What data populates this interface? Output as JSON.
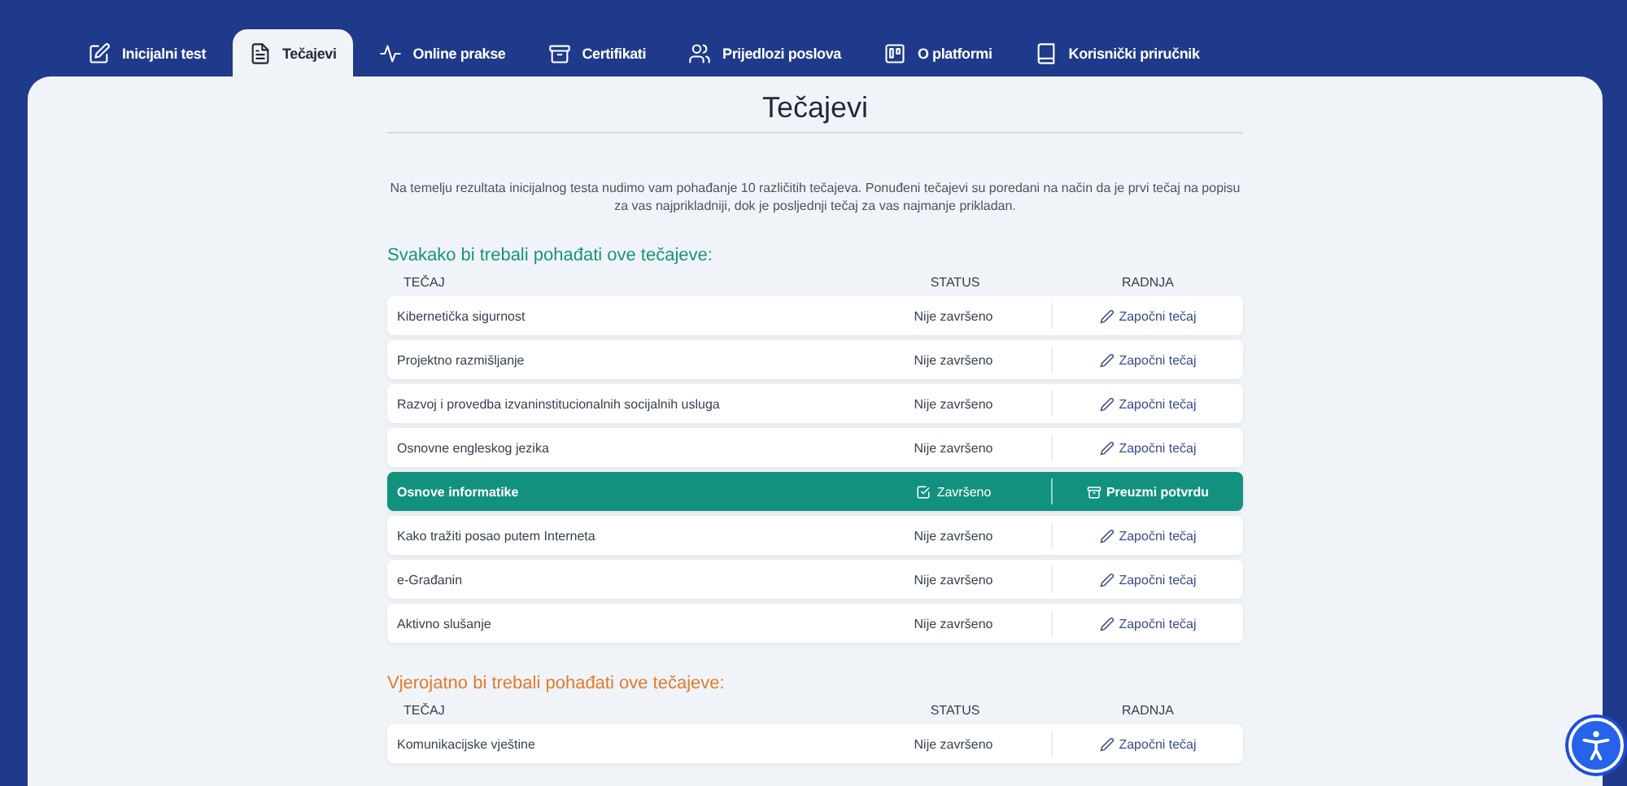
{
  "tabs": [
    {
      "label": "Inicijalni test",
      "kind": "test",
      "selected": false
    },
    {
      "label": "Tečajevi",
      "kind": "courses",
      "selected": true
    },
    {
      "label": "Online prakse",
      "kind": "practice",
      "selected": false
    },
    {
      "label": "Certifikati",
      "kind": "certificates",
      "selected": false
    },
    {
      "label": "Prijedlozi poslova",
      "kind": "jobs",
      "selected": false
    },
    {
      "label": "O platformi",
      "kind": "about",
      "selected": false
    },
    {
      "label": "Korisnički priručnik",
      "kind": "manual",
      "selected": false
    }
  ],
  "page": {
    "title": "Tečajevi",
    "intro": "Na temelju rezultata inicijalnog testa nudimo vam pohađanje 10 različitih tečajeva. Ponuđeni tečajevi su poredani na način da je prvi tečaj na popisu za vas najprikladniji, dok je posljednji tečaj za vas najmanje prikladan."
  },
  "sections": [
    {
      "heading": "Svakako bi trebali pohađati ove tečajeve:",
      "color": "#16947f",
      "columns": [
        "TEČAJ",
        "STATUS",
        "RADNJA"
      ],
      "rows": [
        {
          "course": "Kibernetička sigurnost",
          "status": "Nije završeno",
          "action": "Započni tečaj",
          "completed": false
        },
        {
          "course": "Projektno razmišljanje",
          "status": "Nije završeno",
          "action": "Započni tečaj",
          "completed": false
        },
        {
          "course": "Razvoj i provedba izvaninstitucionalnih socijalnih usluga",
          "status": "Nije završeno",
          "action": "Započni tečaj",
          "completed": false
        },
        {
          "course": "Osnovne engleskog jezika",
          "status": "Nije završeno",
          "action": "Započni tečaj",
          "completed": false
        },
        {
          "course": "Osnove informatike",
          "status": "Završeno",
          "action": "Preuzmi potvrdu",
          "completed": true
        },
        {
          "course": "Kako tražiti posao putem Interneta",
          "status": "Nije završeno",
          "action": "Započni tečaj",
          "completed": false
        },
        {
          "course": "e-Građanin",
          "status": "Nije završeno",
          "action": "Započni tečaj",
          "completed": false
        },
        {
          "course": "Aktivno slušanje",
          "status": "Nije završeno",
          "action": "Započni tečaj",
          "completed": false
        }
      ]
    },
    {
      "heading": "Vjerojatno bi trebali pohađati ove tečajeve:",
      "color": "#e07b2c",
      "columns": [
        "TEČAJ",
        "STATUS",
        "RADNJA"
      ],
      "rows": [
        {
          "course": "Komunikacijske vještine",
          "status": "Nije završeno",
          "action": "Započni tečaj",
          "completed": false
        }
      ]
    }
  ]
}
